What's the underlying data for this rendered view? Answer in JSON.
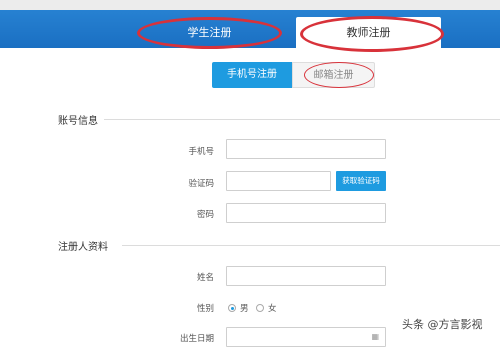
{
  "tabs": {
    "student": "学生注册",
    "teacher": "教师注册"
  },
  "switch": {
    "phone": "手机号注册",
    "email": "邮箱注册"
  },
  "sections": {
    "account": "账号信息",
    "profile": "注册人资料"
  },
  "account": {
    "phone_label": "手机号",
    "code_label": "验证码",
    "code_button": "获取验证码",
    "password_label": "密码"
  },
  "profile": {
    "name_label": "姓名",
    "gender_label": "性别",
    "gender_male": "男",
    "gender_female": "女",
    "birth_label": "出生日期",
    "calendar_icon": "calendar-icon"
  },
  "watermark": "头条 @方言影视",
  "colors": {
    "header": "#1a6fc2",
    "accent": "#1e9be0",
    "annotation": "#d8323a"
  }
}
